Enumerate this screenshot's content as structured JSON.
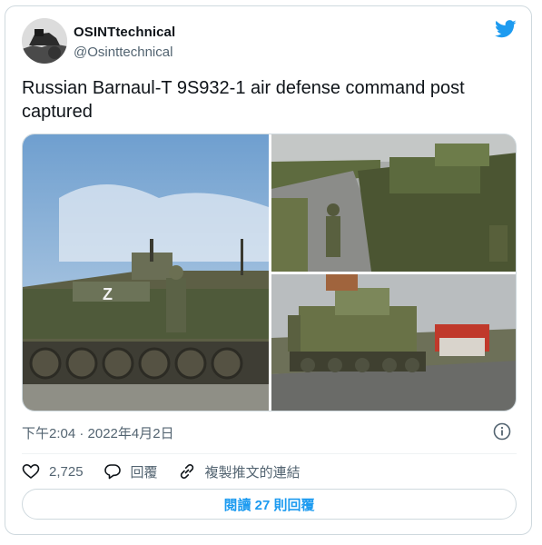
{
  "author": {
    "display_name": "OSINTtechnical",
    "handle": "@Osinttechnical"
  },
  "tweet": {
    "text": "Russian Barnaul-T 9S932-1 air defense command post captured",
    "timestamp": "下午2:04 · 2022年4月2日"
  },
  "media": {
    "photos": [
      {
        "icon": "armored-vehicle-photo",
        "marking": "Z"
      },
      {
        "icon": "armored-vehicle-road-photo"
      },
      {
        "icon": "armored-vehicle-village-photo"
      }
    ]
  },
  "actions": {
    "likes_count": "2,725",
    "reply_label": "回覆",
    "copy_link_label": "複製推文的連結"
  },
  "read_replies_label": "閱讀 27 則回覆",
  "colors": {
    "accent": "#1d9bf0",
    "secondary_text": "#536471",
    "border": "#cfd9de"
  }
}
